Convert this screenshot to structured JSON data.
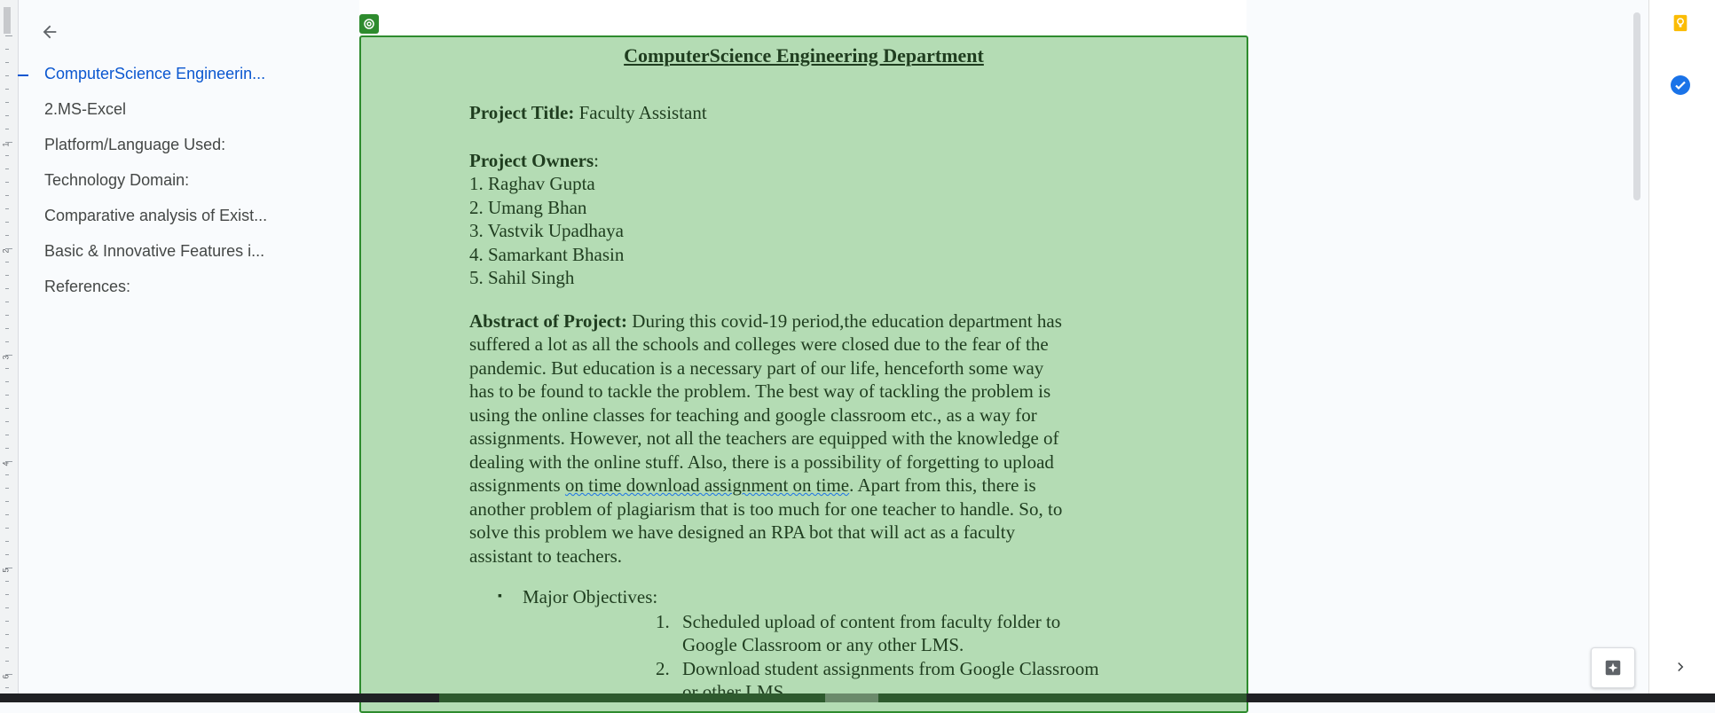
{
  "ruler": {
    "numbers": [
      "1",
      "2",
      "3",
      "4",
      "5",
      "6"
    ]
  },
  "outline": {
    "items": [
      {
        "label": "ComputerScience Engineerin...",
        "active": true
      },
      {
        "label": "2.MS-Excel"
      },
      {
        "label": "Platform/Language Used:"
      },
      {
        "label": "Technology Domain:"
      },
      {
        "label": "Comparative analysis of Exist..."
      },
      {
        "label": "Basic & Innovative Features i..."
      },
      {
        "label": "References:"
      }
    ]
  },
  "doc": {
    "title": "ComputerScience Engineering Department",
    "project_title_label": "Project Title:",
    "project_title_value": " Faculty Assistant",
    "owners_label": "Project Owners",
    "owners_colon": ":",
    "owners": [
      "1. Raghav Gupta",
      "2. Umang Bhan",
      "3. Vastvik Upadhaya",
      "4. Samarkant Bhasin",
      "5. Sahil Singh"
    ],
    "abstract_label": "Abstract of Project:",
    "abstract_lines": [
      " During this covid-19 period,the education department has",
      "suffered a lot as all the schools and colleges were closed due to the fear of the",
      "pandemic. But education is a necessary part of our life, henceforth some way",
      "has to be found to tackle the problem. The best way of tackling the problem is",
      "using the online classes for teaching and google classroom etc., as a way for",
      "assignments. However, not all the teachers are equipped with the knowledge of",
      "dealing with the online stuff. Also, there is a possibility of forgetting to upload"
    ],
    "abstract_line8_pre": "assignments ",
    "abstract_line8_squiggle": "on time download assignment on time",
    "abstract_line8_post": ". Apart from this, there is",
    "abstract_lines_end": [
      "another problem of plagiarism that is too much for one teacher to handle. So, to",
      "solve this problem we have designed an RPA bot that will act as a faculty",
      "assistant to teachers."
    ],
    "bullet": "Major Objectives:",
    "objectives": [
      {
        "n": "1.",
        "lines": [
          "Scheduled upload of content from faculty folder to",
          "Google Classroom or any other LMS."
        ]
      },
      {
        "n": "2.",
        "lines": [
          "Download student assignments from Google Classroom",
          "or other LMS."
        ]
      }
    ]
  },
  "colors": {
    "accent": "#0b57d0",
    "doc_bg": "#b4dcb4",
    "doc_border": "#2e8b2e",
    "keep": "#fbbc04",
    "tasks": "#1a73e8"
  },
  "icons": [
    "arrow-back-icon",
    "box-select-icon",
    "keep-icon",
    "tasks-icon",
    "explore-icon",
    "chevron-right-icon"
  ]
}
